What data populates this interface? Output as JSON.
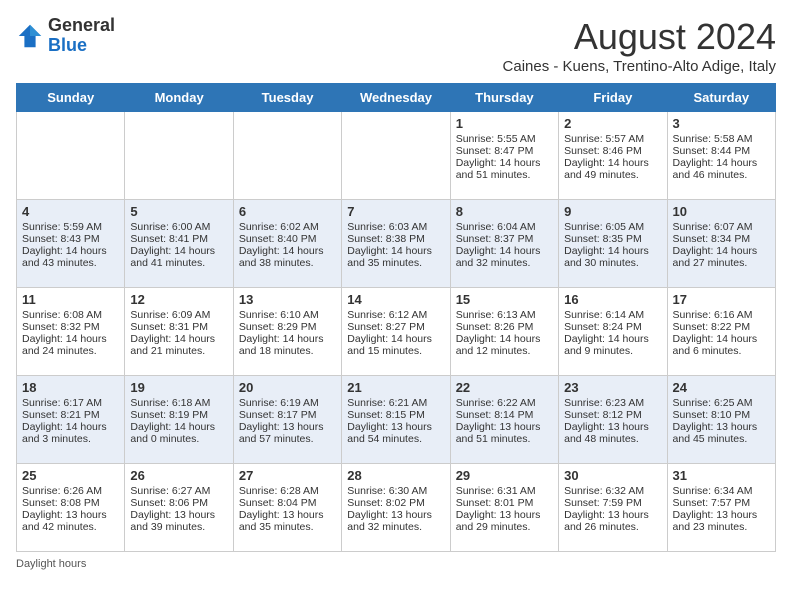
{
  "header": {
    "logo_line1": "General",
    "logo_line2": "Blue",
    "month_year": "August 2024",
    "location": "Caines - Kuens, Trentino-Alto Adige, Italy"
  },
  "days_of_week": [
    "Sunday",
    "Monday",
    "Tuesday",
    "Wednesday",
    "Thursday",
    "Friday",
    "Saturday"
  ],
  "weeks": [
    [
      {
        "day": "",
        "info": ""
      },
      {
        "day": "",
        "info": ""
      },
      {
        "day": "",
        "info": ""
      },
      {
        "day": "",
        "info": ""
      },
      {
        "day": "1",
        "info": "Sunrise: 5:55 AM\nSunset: 8:47 PM\nDaylight: 14 hours and 51 minutes."
      },
      {
        "day": "2",
        "info": "Sunrise: 5:57 AM\nSunset: 8:46 PM\nDaylight: 14 hours and 49 minutes."
      },
      {
        "day": "3",
        "info": "Sunrise: 5:58 AM\nSunset: 8:44 PM\nDaylight: 14 hours and 46 minutes."
      }
    ],
    [
      {
        "day": "4",
        "info": "Sunrise: 5:59 AM\nSunset: 8:43 PM\nDaylight: 14 hours and 43 minutes."
      },
      {
        "day": "5",
        "info": "Sunrise: 6:00 AM\nSunset: 8:41 PM\nDaylight: 14 hours and 41 minutes."
      },
      {
        "day": "6",
        "info": "Sunrise: 6:02 AM\nSunset: 8:40 PM\nDaylight: 14 hours and 38 minutes."
      },
      {
        "day": "7",
        "info": "Sunrise: 6:03 AM\nSunset: 8:38 PM\nDaylight: 14 hours and 35 minutes."
      },
      {
        "day": "8",
        "info": "Sunrise: 6:04 AM\nSunset: 8:37 PM\nDaylight: 14 hours and 32 minutes."
      },
      {
        "day": "9",
        "info": "Sunrise: 6:05 AM\nSunset: 8:35 PM\nDaylight: 14 hours and 30 minutes."
      },
      {
        "day": "10",
        "info": "Sunrise: 6:07 AM\nSunset: 8:34 PM\nDaylight: 14 hours and 27 minutes."
      }
    ],
    [
      {
        "day": "11",
        "info": "Sunrise: 6:08 AM\nSunset: 8:32 PM\nDaylight: 14 hours and 24 minutes."
      },
      {
        "day": "12",
        "info": "Sunrise: 6:09 AM\nSunset: 8:31 PM\nDaylight: 14 hours and 21 minutes."
      },
      {
        "day": "13",
        "info": "Sunrise: 6:10 AM\nSunset: 8:29 PM\nDaylight: 14 hours and 18 minutes."
      },
      {
        "day": "14",
        "info": "Sunrise: 6:12 AM\nSunset: 8:27 PM\nDaylight: 14 hours and 15 minutes."
      },
      {
        "day": "15",
        "info": "Sunrise: 6:13 AM\nSunset: 8:26 PM\nDaylight: 14 hours and 12 minutes."
      },
      {
        "day": "16",
        "info": "Sunrise: 6:14 AM\nSunset: 8:24 PM\nDaylight: 14 hours and 9 minutes."
      },
      {
        "day": "17",
        "info": "Sunrise: 6:16 AM\nSunset: 8:22 PM\nDaylight: 14 hours and 6 minutes."
      }
    ],
    [
      {
        "day": "18",
        "info": "Sunrise: 6:17 AM\nSunset: 8:21 PM\nDaylight: 14 hours and 3 minutes."
      },
      {
        "day": "19",
        "info": "Sunrise: 6:18 AM\nSunset: 8:19 PM\nDaylight: 14 hours and 0 minutes."
      },
      {
        "day": "20",
        "info": "Sunrise: 6:19 AM\nSunset: 8:17 PM\nDaylight: 13 hours and 57 minutes."
      },
      {
        "day": "21",
        "info": "Sunrise: 6:21 AM\nSunset: 8:15 PM\nDaylight: 13 hours and 54 minutes."
      },
      {
        "day": "22",
        "info": "Sunrise: 6:22 AM\nSunset: 8:14 PM\nDaylight: 13 hours and 51 minutes."
      },
      {
        "day": "23",
        "info": "Sunrise: 6:23 AM\nSunset: 8:12 PM\nDaylight: 13 hours and 48 minutes."
      },
      {
        "day": "24",
        "info": "Sunrise: 6:25 AM\nSunset: 8:10 PM\nDaylight: 13 hours and 45 minutes."
      }
    ],
    [
      {
        "day": "25",
        "info": "Sunrise: 6:26 AM\nSunset: 8:08 PM\nDaylight: 13 hours and 42 minutes."
      },
      {
        "day": "26",
        "info": "Sunrise: 6:27 AM\nSunset: 8:06 PM\nDaylight: 13 hours and 39 minutes."
      },
      {
        "day": "27",
        "info": "Sunrise: 6:28 AM\nSunset: 8:04 PM\nDaylight: 13 hours and 35 minutes."
      },
      {
        "day": "28",
        "info": "Sunrise: 6:30 AM\nSunset: 8:02 PM\nDaylight: 13 hours and 32 minutes."
      },
      {
        "day": "29",
        "info": "Sunrise: 6:31 AM\nSunset: 8:01 PM\nDaylight: 13 hours and 29 minutes."
      },
      {
        "day": "30",
        "info": "Sunrise: 6:32 AM\nSunset: 7:59 PM\nDaylight: 13 hours and 26 minutes."
      },
      {
        "day": "31",
        "info": "Sunrise: 6:34 AM\nSunset: 7:57 PM\nDaylight: 13 hours and 23 minutes."
      }
    ]
  ],
  "footer": {
    "daylight_hours": "Daylight hours"
  }
}
